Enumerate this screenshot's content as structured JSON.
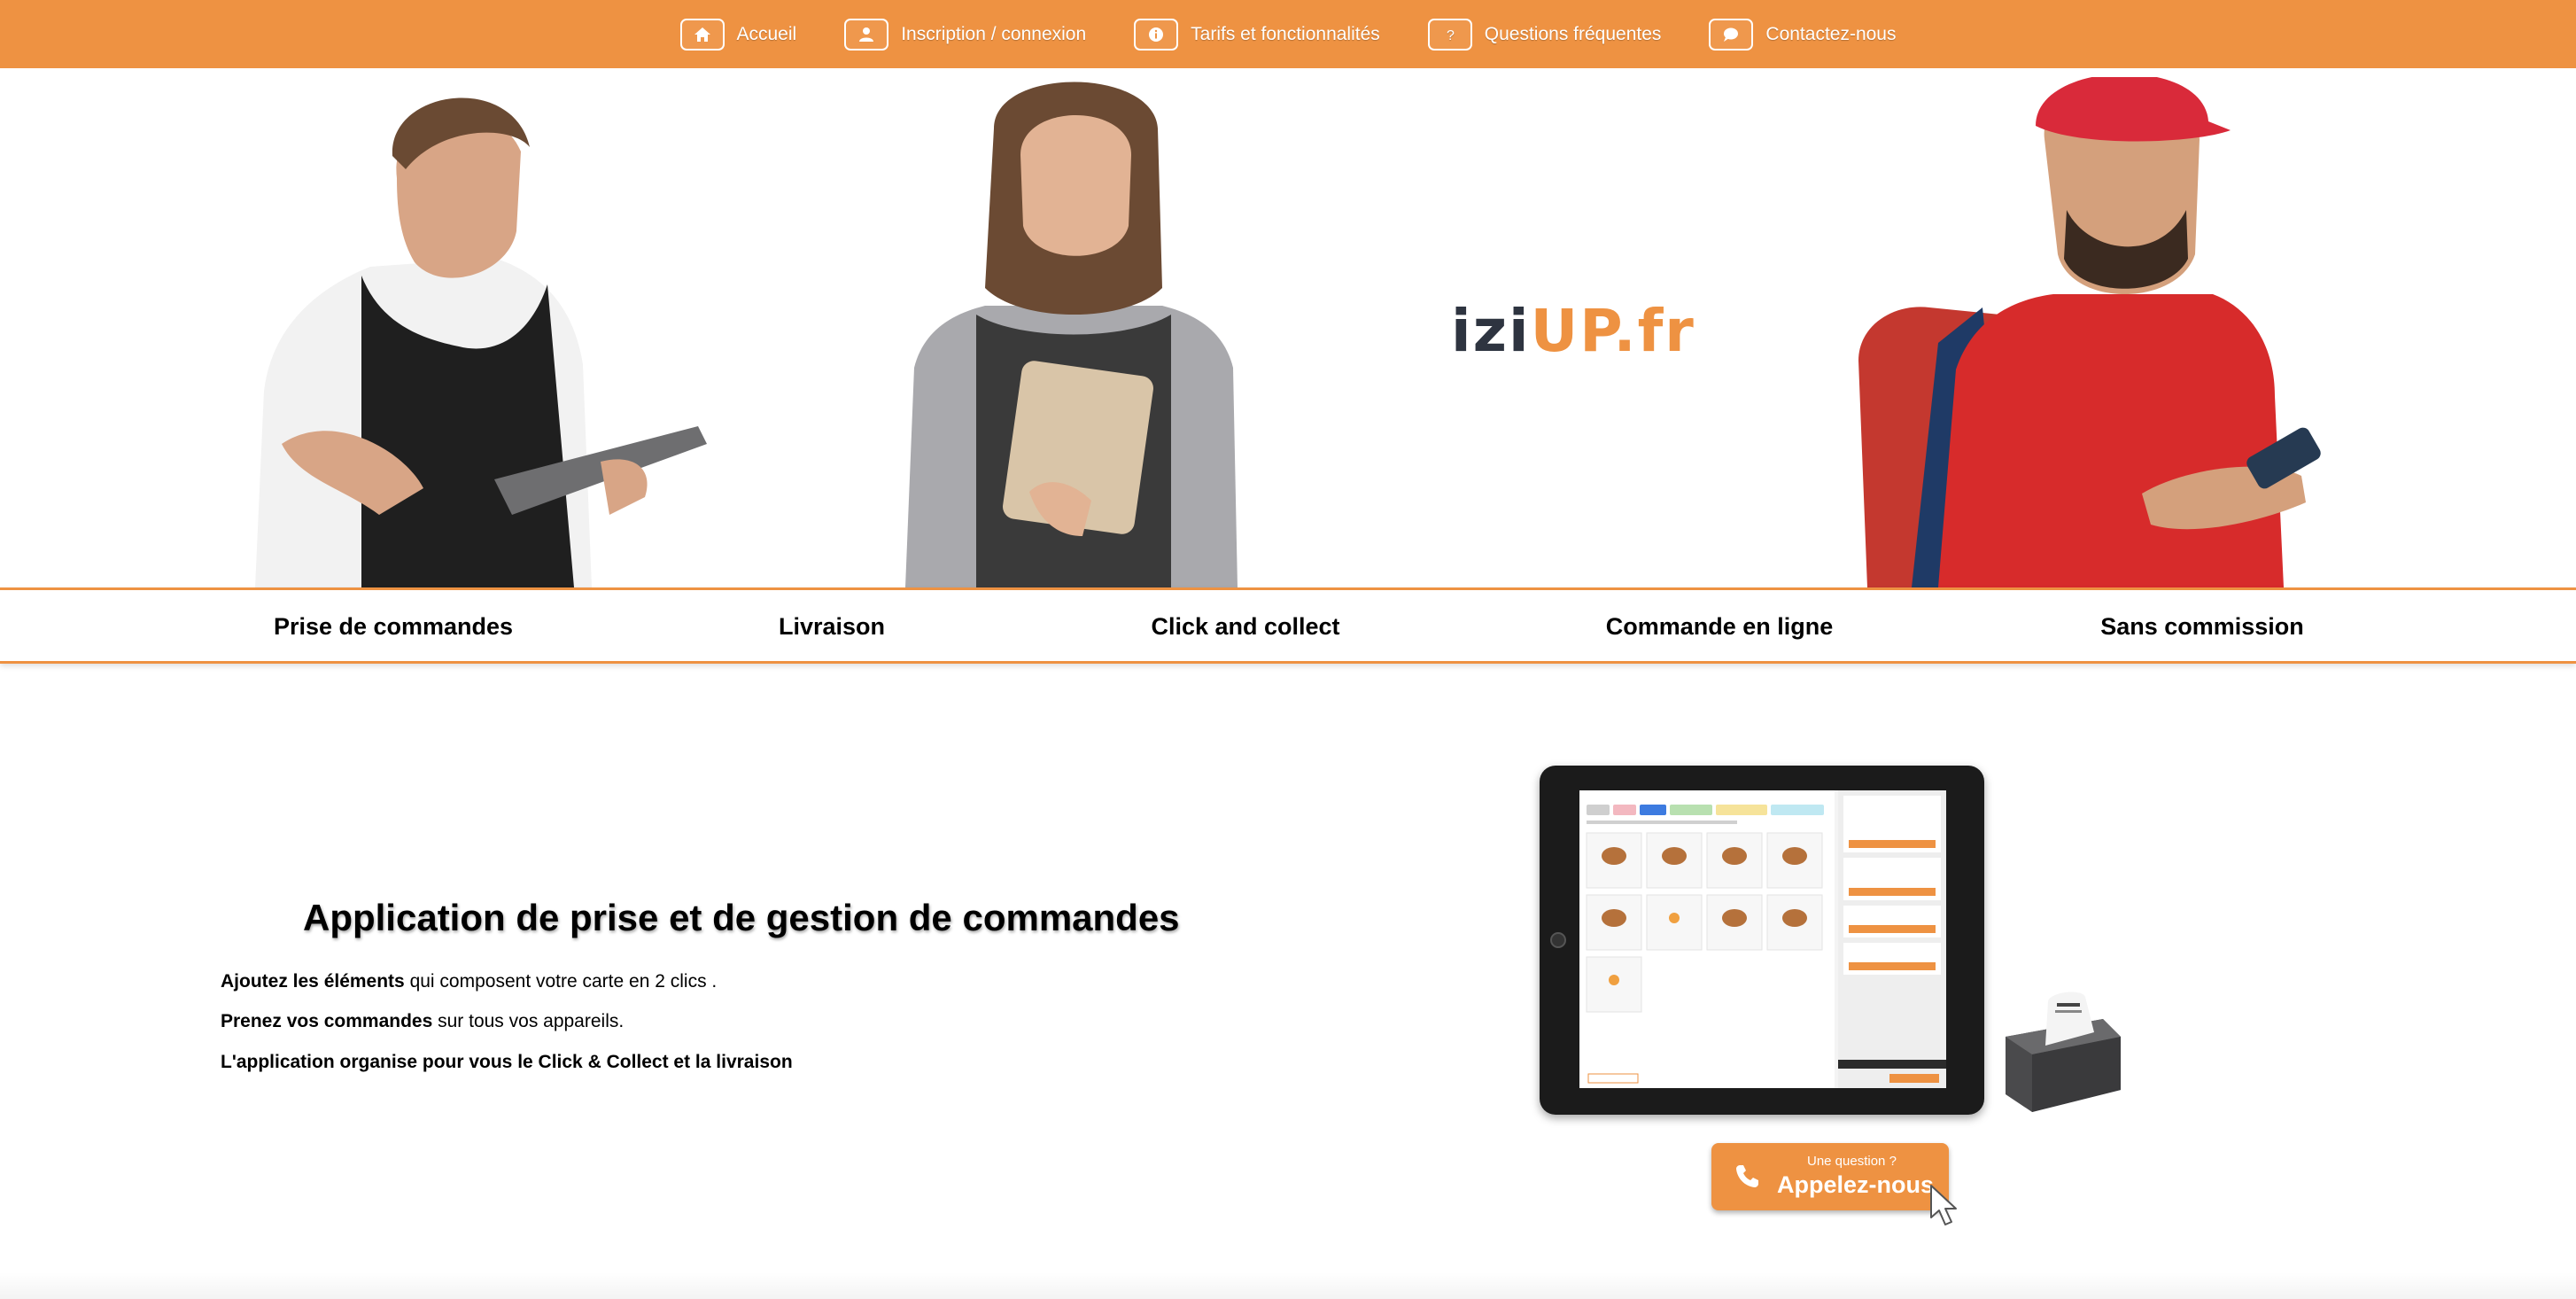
{
  "nav": {
    "items": [
      {
        "label": "Accueil",
        "icon": "home-icon"
      },
      {
        "label": "Inscription / connexion",
        "icon": "user-icon"
      },
      {
        "label": "Tarifs et fonctionnalités",
        "icon": "info-icon"
      },
      {
        "label": "Questions fréquentes",
        "icon": "question-icon"
      },
      {
        "label": "Contactez-nous",
        "icon": "chat-icon"
      }
    ]
  },
  "hero": {
    "logo_part1": "izi",
    "logo_part2": "UP.fr"
  },
  "features": [
    "Prise de commandes",
    "Livraison",
    "Click and collect",
    "Commande en ligne",
    "Sans commission"
  ],
  "content": {
    "headline": "Application de prise et de gestion de commandes",
    "line1_bold": "Ajoutez les éléments",
    "line1_rest": " qui composent votre carte en 2 clics .",
    "line2_bold": "Prenez vos commandes",
    "line2_rest": " sur tous vos appareils.",
    "line3_bold": "L'application organise pour vous le Click & Collect et la livraison"
  },
  "call": {
    "small": "Une question ?",
    "big": "Appelez-nous"
  },
  "colors": {
    "accent": "#ee9242",
    "logo_dark": "#2e3440"
  }
}
